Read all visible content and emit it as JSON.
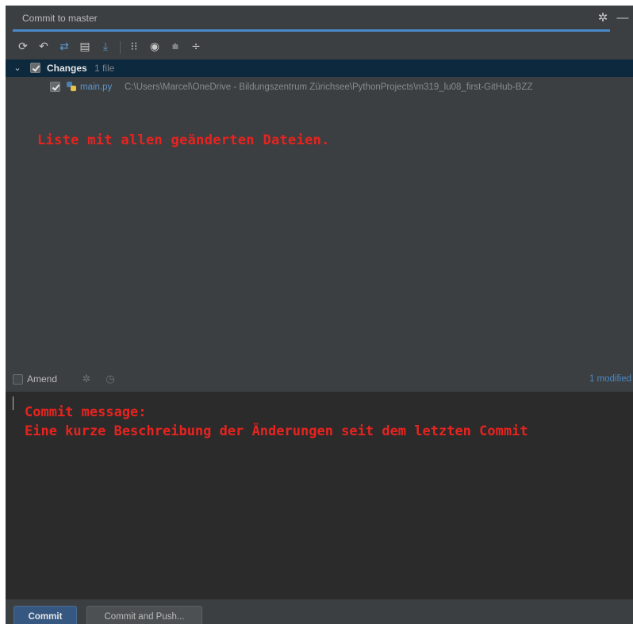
{
  "header": {
    "tab_label": "Commit to master",
    "icons": [
      "gear-icon",
      "minimize-icon"
    ]
  },
  "toolbar": {
    "buttons": [
      "refresh-icon",
      "rollback-icon",
      "diff-icon",
      "shelve-icon",
      "download-icon",
      "group-by-icon",
      "show-icon",
      "expand-all-icon",
      "collapse-all-icon"
    ]
  },
  "changes": {
    "group_label": "Changes",
    "count": "1 file",
    "file": {
      "name": "main.py",
      "path": "C:\\Users\\Marcel\\OneDrive - Bildungszentrum Zürichsee\\PythonProjects\\m319_lu08_first-GitHub-BZZ"
    }
  },
  "annotations": {
    "list_note": "Liste mit allen geänderten Dateien.",
    "message_title": "Commit message:",
    "message_body": "Eine kurze Beschreibung der Änderungen seit dem letzten Commit"
  },
  "amend": {
    "label": "Amend",
    "status": "1 modified"
  },
  "buttons": {
    "commit": "Commit",
    "commit_push": "Commit and Push..."
  },
  "colors": {
    "accent": "#4a88c7",
    "annotation": "#e8231f",
    "background": "#3c3f41",
    "editor_background": "#2b2b2b"
  }
}
